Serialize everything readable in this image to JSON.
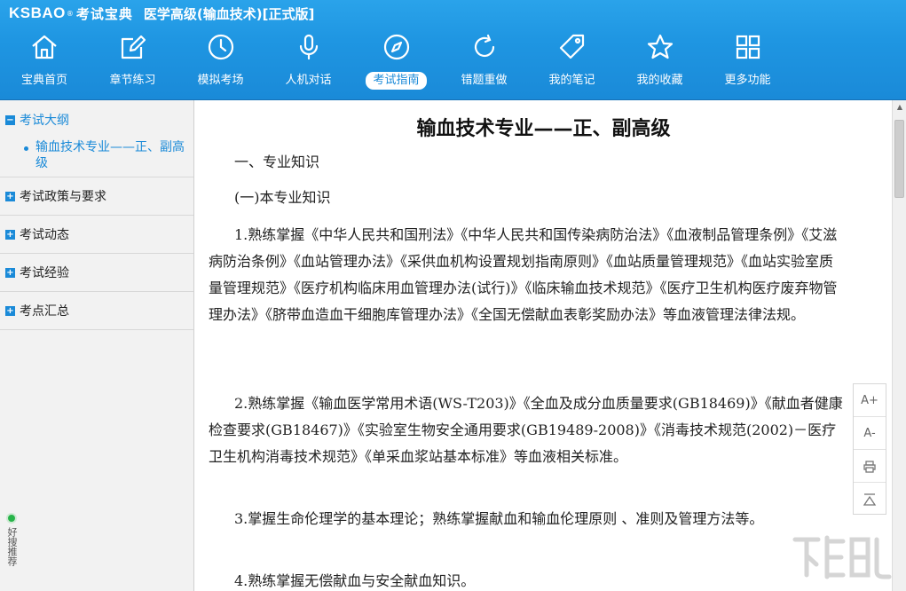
{
  "header": {
    "logo_text": "KSBAO",
    "logo_reg": "®",
    "logo_cn": "考试宝典",
    "app_title": "医学高级(输血技术)[正式版]"
  },
  "nav": {
    "items": [
      {
        "label": "宝典首页",
        "icon": "home-icon"
      },
      {
        "label": "章节练习",
        "icon": "edit-icon"
      },
      {
        "label": "模拟考场",
        "icon": "clock-icon"
      },
      {
        "label": "人机对话",
        "icon": "microphone-icon"
      },
      {
        "label": "考试指南",
        "icon": "compass-icon",
        "active": true
      },
      {
        "label": "错题重做",
        "icon": "refresh-icon"
      },
      {
        "label": "我的笔记",
        "icon": "tag-icon"
      },
      {
        "label": "我的收藏",
        "icon": "star-icon"
      },
      {
        "label": "更多功能",
        "icon": "grid-icon"
      }
    ]
  },
  "sidebar": {
    "sections": [
      {
        "label": "考试大纲",
        "toggle": "−",
        "open": true,
        "children": [
          "输血技术专业——正、副高级"
        ]
      },
      {
        "label": "考试政策与要求",
        "toggle": "+"
      },
      {
        "label": "考试动态",
        "toggle": "+"
      },
      {
        "label": "考试经验",
        "toggle": "+"
      },
      {
        "label": "考点汇总",
        "toggle": "+"
      }
    ],
    "good_search": "好搜推荐"
  },
  "content": {
    "title": "输血技术专业——正、副高级",
    "heading1": "一、专业知识",
    "heading2": "(一)本专业知识",
    "p1": "1.熟练掌握《中华人民共和国刑法》《中华人民共和国传染病防治法》《血液制品管理条例》《艾滋病防治条例》《血站管理办法》《采供血机构设置规划指南原则》《血站质量管理规范》《血站实验室质量管理规范》《医疗机构临床用血管理办法(试行)》《临床输血技术规范》《医疗卫生机构医疗废弃物管理办法》《脐带血造血干细胞库管理办法》《全国无偿献血表彰奖励办法》等血液管理法律法规。",
    "p2": "2.熟练掌握《输血医学常用术语(WS-T203)》《全血及成分血质量要求(GB18469)》《献血者健康检查要求(GB18467)》《实验室生物安全通用要求(GB19489-2008)》《消毒技术规范(2002)－医疗卫生机构消毒技术规范》《单采血浆站基本标准》等血液相关标准。",
    "p3": "3.掌握生命伦理学的基本理论；熟练掌握献血和输血伦理原则 、准则及管理方法等。",
    "p4": "4.熟练掌握无偿献血与安全献血知识。"
  },
  "tools": {
    "font_larger": "A+",
    "font_smaller": "A-"
  }
}
